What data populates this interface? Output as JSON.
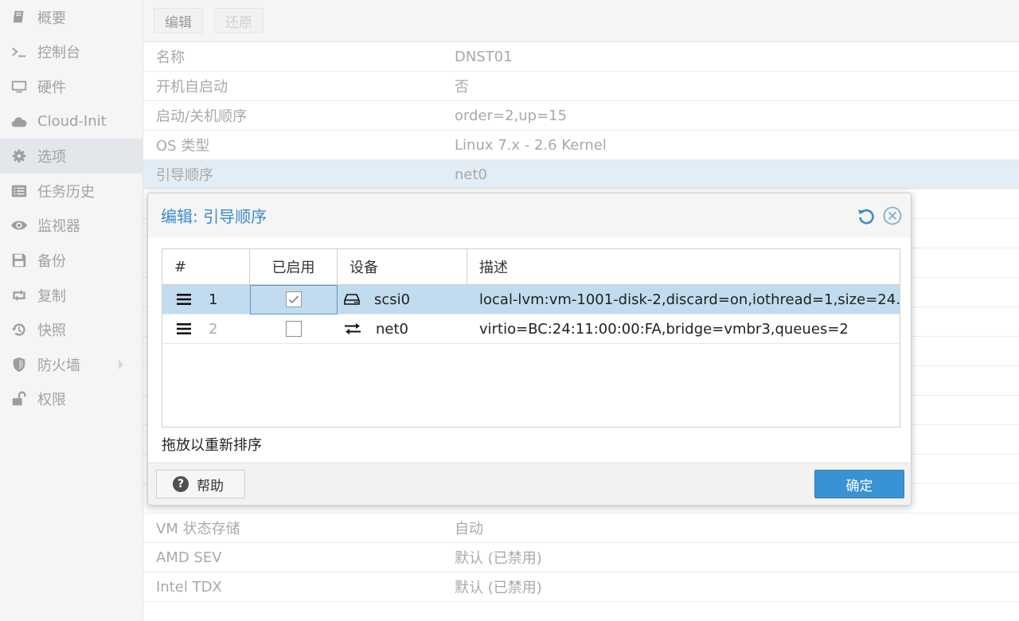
{
  "sidebar": {
    "items": [
      {
        "label": "概要",
        "icon": "book-icon"
      },
      {
        "label": "控制台",
        "icon": "terminal-icon"
      },
      {
        "label": "硬件",
        "icon": "monitor-icon"
      },
      {
        "label": "Cloud-Init",
        "icon": "cloud-icon"
      },
      {
        "label": "选项",
        "icon": "gear-icon",
        "active": true
      },
      {
        "label": "任务历史",
        "icon": "list-icon"
      },
      {
        "label": "监视器",
        "icon": "eye-icon"
      },
      {
        "label": "备份",
        "icon": "floppy-icon"
      },
      {
        "label": "复制",
        "icon": "retweet-icon"
      },
      {
        "label": "快照",
        "icon": "history-icon"
      },
      {
        "label": "防火墙",
        "icon": "shield-icon",
        "has_submenu": true
      },
      {
        "label": "权限",
        "icon": "unlock-icon"
      }
    ]
  },
  "toolbar": {
    "edit_label": "编辑",
    "revert_label": "还原"
  },
  "options": {
    "rows": [
      {
        "key": "名称",
        "value": "DNST01"
      },
      {
        "key": "开机自启动",
        "value": "否"
      },
      {
        "key": "启动/关机顺序",
        "value": "order=2,up=15"
      },
      {
        "key": "OS 类型",
        "value": "Linux 7.x - 2.6 Kernel"
      },
      {
        "key": "引导顺序",
        "value": "net0"
      }
    ],
    "bottom_rows": [
      {
        "key": "VM 状态存储",
        "value": "自动"
      },
      {
        "key": "AMD SEV",
        "value": "默认 (已禁用)"
      },
      {
        "key": "Intel TDX",
        "value": "默认 (已禁用)"
      }
    ]
  },
  "dialog": {
    "title": "编辑: 引导顺序",
    "columns": {
      "num": "#",
      "enabled": "已启用",
      "device": "设备",
      "desc": "描述"
    },
    "rows": [
      {
        "num": "1",
        "enabled": true,
        "device": "scsi0",
        "device_icon": "hdd-icon",
        "desc": "local-lvm:vm-1001-disk-2,discard=on,iothread=1,size=24…"
      },
      {
        "num": "2",
        "enabled": false,
        "device": "net0",
        "device_icon": "exchange-icon",
        "desc": "virtio=BC:24:11:00:00:FA,bridge=vmbr3,queues=2"
      }
    ],
    "hint": "拖放以重新排序",
    "help_label": "帮助",
    "ok_label": "确定"
  },
  "colors": {
    "accent": "#3892d3",
    "title": "#3b8bc9",
    "selected_row": "#c2dcef"
  }
}
